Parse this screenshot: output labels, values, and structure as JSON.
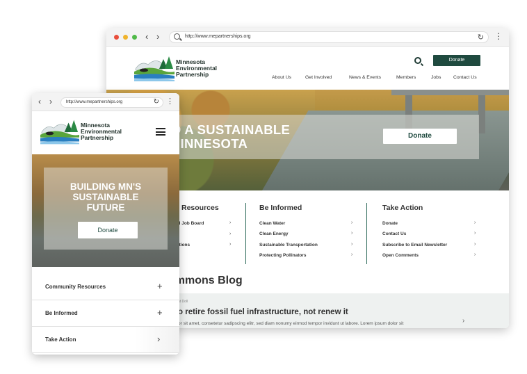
{
  "desktop": {
    "url": "http://www.mepartnerships.org",
    "logo": {
      "line1": "Minnesota",
      "line2": "Environmental",
      "line3": "Partnership"
    },
    "donate_label": "Donate",
    "nav": [
      "About Us",
      "Get Involved",
      "News & Events",
      "Members",
      "Jobs",
      "Contact Us"
    ],
    "hero": {
      "title": "P US BUILD A SUSTAINABLE\nURE FOR MINNESOTA",
      "donate_label": "Donate"
    },
    "columns": [
      {
        "title": "Resources",
        "links": [
          "al Job Board",
          "",
          "ations"
        ]
      },
      {
        "title": "Be Informed",
        "links": [
          "Clean Water",
          "Clean Energy",
          "Sustainable Transportation",
          "Protecting Pollinators"
        ]
      },
      {
        "title": "Take Action",
        "links": [
          "Donate",
          "Contact Us",
          "Subscribe to Email Newsletter",
          "Open Comments"
        ]
      }
    ],
    "blog": {
      "title": "ommons Blog",
      "tag": "at Doll",
      "headline": "o retire fossil fuel infrastructure, not renew it",
      "excerpt": "or sit amet, consetetur sadipscing elitr, sed diam nonumy eirmod tempor invidunt ut labore. Lorem ipsum dolor sit"
    }
  },
  "mobile": {
    "url": "http://www.mepartnerships.org",
    "logo": {
      "line1": "Minnesota",
      "line2": "Environmental",
      "line3": "Partnership"
    },
    "hero": {
      "title": "BUILDING MN'S\nSUSTAINABLE\nFUTURE",
      "donate_label": "Donate"
    },
    "accordion": [
      {
        "label": "Community Resources",
        "icon": "+"
      },
      {
        "label": "Be Informed",
        "icon": "+"
      },
      {
        "label": "Take Action",
        "icon": "›"
      }
    ]
  },
  "colors": {
    "brand": "#1f4a3f",
    "accent_line": "#2d6a5a"
  }
}
